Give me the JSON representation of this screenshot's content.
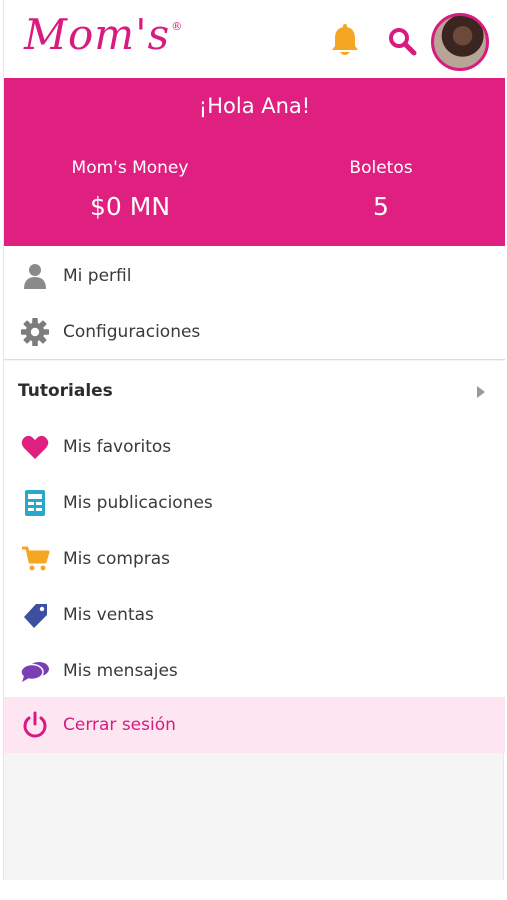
{
  "header": {
    "logo_text": "Mom's",
    "logo_mark": "®",
    "bell_icon": "bell-icon",
    "search_icon": "search-icon",
    "avatar_alt": "profile photo"
  },
  "banner": {
    "greeting": "¡Hola Ana!",
    "money_label": "Mom's Money",
    "money_value": "$0 MN",
    "tickets_label": "Boletos",
    "tickets_value": "5"
  },
  "menu": {
    "profile": "Mi perfil",
    "settings": "Configuraciones",
    "tutorials": "Tutoriales",
    "favorites": "Mis favoritos",
    "publications": "Mis publicaciones",
    "purchases": "Mis compras",
    "sales": "Mis ventas",
    "messages": "Mis mensajes",
    "logout": "Cerrar sesión"
  },
  "colors": {
    "brand": "#e02080",
    "bell": "#f5a623",
    "publications": "#29a8c9",
    "purchases": "#f5a623",
    "sales": "#3d4fa0",
    "messages": "#7b3fb5",
    "logout_bg": "#fde6f1"
  }
}
